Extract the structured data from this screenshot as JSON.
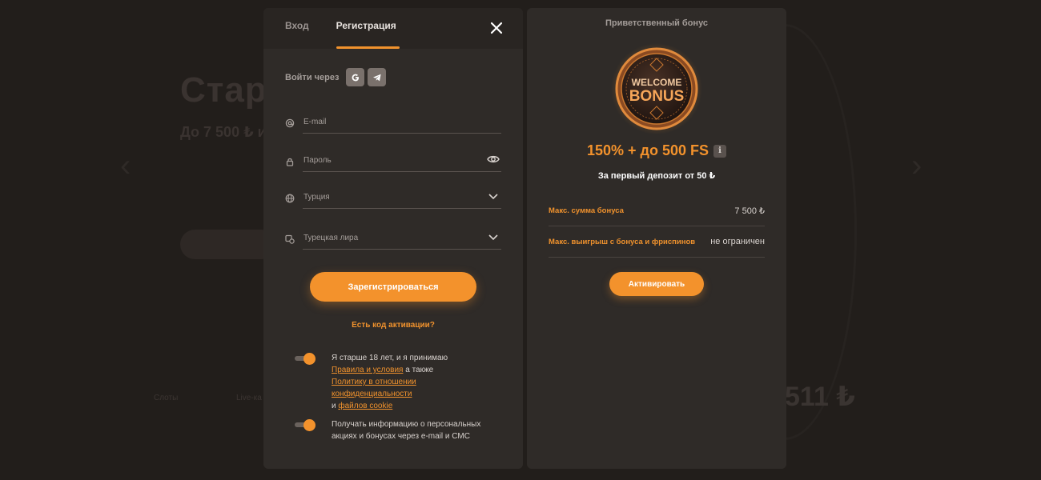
{
  "background": {
    "title": "Стар",
    "subtitle": "До 7 500 ₺ и",
    "jackpot": "511 ₺",
    "small_labels": [
      "Слоты",
      "Live-ка"
    ]
  },
  "register": {
    "tabs": [
      {
        "label": "Вход",
        "active": false
      },
      {
        "label": "Регистрация",
        "active": true
      }
    ],
    "social_label": "Войти через",
    "social_buttons": [
      "google-icon",
      "telegram-icon"
    ],
    "email_placeholder": "E-mail",
    "password_placeholder": "Пароль",
    "country_value": "Турция",
    "currency_value": "Турецкая лира",
    "submit_label": "Зарегистрироваться",
    "activation_code_link": "Есть код активации?",
    "consent_terms": {
      "line1": "Я старше 18 лет, и я принимаю",
      "terms_link": "Правила и условия",
      "also": " а также",
      "privacy_link_1": "Политику в отношении",
      "privacy_link_2": "конфиденциальности",
      "and": "и ",
      "cookie_link": "файлов cookie"
    },
    "consent_marketing": "Получать информацию о персональных акциях и бонусах через e-mail и СМС",
    "colors": {
      "accent": "#f3922c",
      "panel": "#2f2b28"
    }
  },
  "bonus": {
    "header": "Приветственный бонус",
    "coin_line1": "WELCOME",
    "coin_line2": "BONUS",
    "offer": "150% + до 500 FS",
    "info_icon": "i",
    "deposit_text": "За первый депозит от 50 ₺",
    "rows": [
      {
        "label": "Макс. сумма бонуса",
        "value": "7 500 ₺"
      },
      {
        "label": "Макс. выигрыш с бонуса и фриспинов",
        "value": "не ограничен"
      }
    ],
    "activate_label": "Активировать"
  }
}
